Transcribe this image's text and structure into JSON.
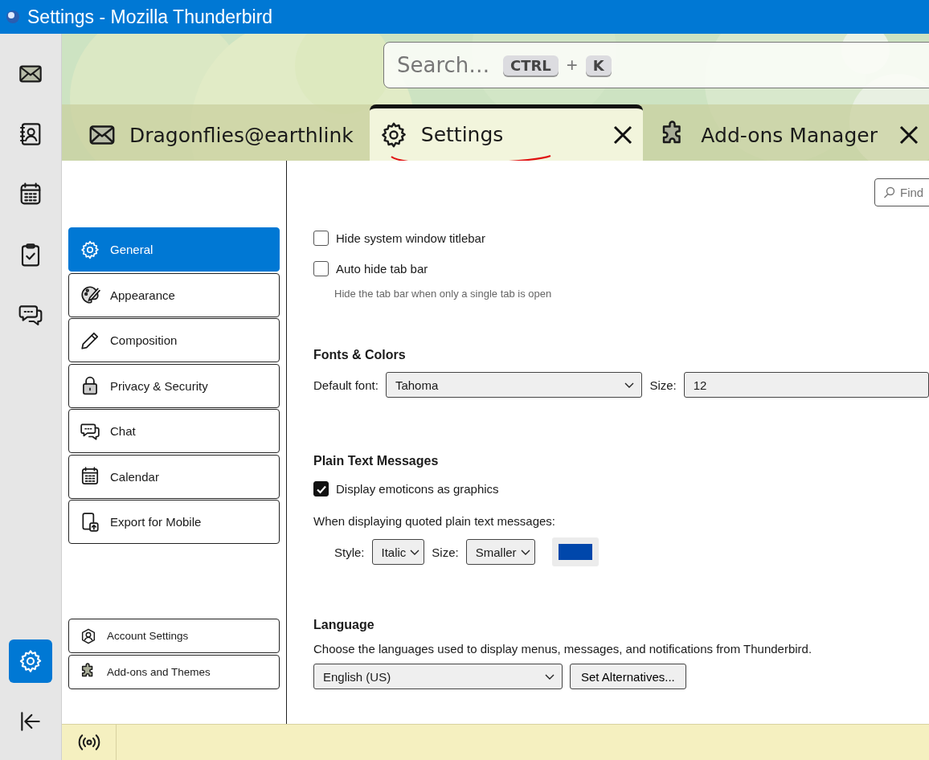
{
  "window": {
    "title": "Settings - Mozilla Thunderbird"
  },
  "spaces": [
    {
      "kind": "mail",
      "selected": false
    },
    {
      "kind": "contacts",
      "selected": false
    },
    {
      "kind": "calendar",
      "selected": false
    },
    {
      "kind": "tasks",
      "selected": false
    },
    {
      "kind": "chat",
      "selected": false
    }
  ],
  "spaces_bottom": [
    {
      "kind": "settings",
      "selected": true
    },
    {
      "kind": "collapse",
      "selected": false
    }
  ],
  "search": {
    "placeholder": "Search…",
    "keys": [
      "CTRL",
      "K"
    ],
    "joiner": "+"
  },
  "tabs": [
    {
      "kind": "mail",
      "label": "Dragonflies@earthlink",
      "selected": false,
      "closable": false
    },
    {
      "kind": "settings",
      "label": "Settings",
      "selected": true,
      "closable": true
    },
    {
      "kind": "addons",
      "label": "Add-ons Manager",
      "selected": false,
      "closable": true
    }
  ],
  "find": {
    "placeholder": "Find"
  },
  "nav": [
    {
      "kind": "settings",
      "label": "General",
      "selected": true
    },
    {
      "kind": "palette",
      "label": "Appearance",
      "selected": false
    },
    {
      "kind": "pencil",
      "label": "Composition",
      "selected": false
    },
    {
      "kind": "lock",
      "label": "Privacy & Security",
      "selected": false
    },
    {
      "kind": "chat",
      "label": "Chat",
      "selected": false
    },
    {
      "kind": "calendar",
      "label": "Calendar",
      "selected": false
    },
    {
      "kind": "mobile",
      "label": "Export for Mobile",
      "selected": false
    }
  ],
  "nav_bottom": [
    {
      "kind": "account",
      "label": "Account Settings"
    },
    {
      "kind": "addons",
      "label": "Add-ons and Themes"
    }
  ],
  "options": [
    {
      "label": "Hide system window titlebar",
      "checked": false
    },
    {
      "label": "Auto hide tab bar",
      "checked": false,
      "hint": "Hide the tab bar when only a single tab is open"
    }
  ],
  "fonts": {
    "heading": "Fonts & Colors",
    "font_label": "Default font:",
    "font_value": "Tahoma",
    "size_label": "Size:",
    "size_value": "12"
  },
  "plain_text": {
    "heading": "Plain Text Messages",
    "option": {
      "label": "Display emoticons as graphics",
      "checked": true
    },
    "quoted_label": "When displaying quoted plain text messages:",
    "style_label": "Style:",
    "style_value": "Italic",
    "size_label": "Size:",
    "size_value": "Smaller",
    "color": "#0047ab"
  },
  "language": {
    "heading": "Language",
    "description": "Choose the languages used to display menus, messages, and notifications from Thunderbird.",
    "value": "English (US)",
    "button": "Set Alternatives..."
  }
}
